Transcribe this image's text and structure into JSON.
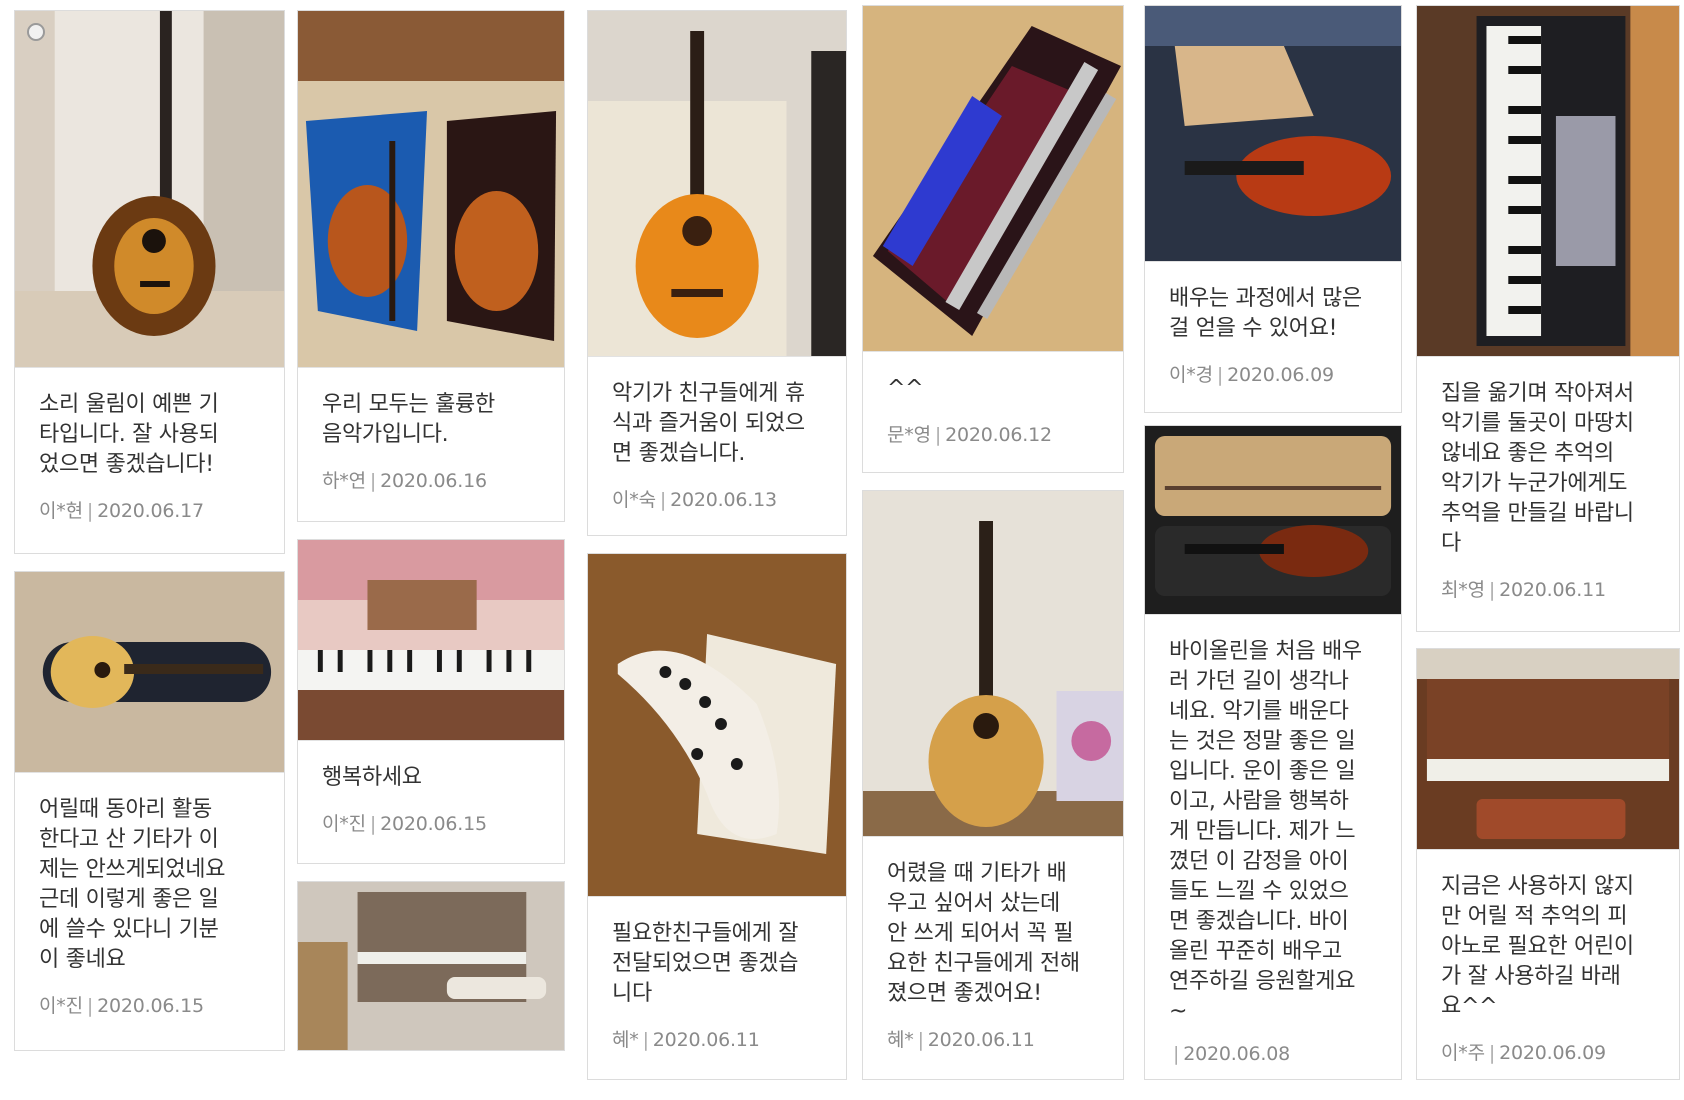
{
  "cards": [
    {
      "message": "소리 울림이 예쁜 기\n타입니다. 잘 사용되\n었으면 좋겠습니다!",
      "author": "이*현",
      "date": "2020.06.17",
      "photo": "acoustic-guitar-sunburst-photo"
    },
    {
      "message": "어릴때 동아리 활동\n한다고 산 기타가 이\n제는 안쓰게되었네요\n근데 이렇게 좋은 일\n에 쓸수 있다니 기분\n이 좋네요",
      "author": "이*진",
      "date": "2020.06.15",
      "photo": "guitar-in-case-photo"
    },
    {
      "message": "우리 모두는 훌륭한\n음악가입니다.",
      "author": "하*연",
      "date": "2020.06.16",
      "photo": "violins-in-cases-photo"
    },
    {
      "message": "행복하세요",
      "author": "이*진",
      "date": "2020.06.15",
      "photo": "keyboard-piano-photo"
    },
    {
      "message": "",
      "author": "",
      "date": "",
      "photo": "upright-piano-photo"
    },
    {
      "message": "악기가 친구들에게 휴\n식과 즐거움이 되었으\n면 좋겠습니다.",
      "author": "이*숙",
      "date": "2020.06.13",
      "photo": "classical-guitar-photo"
    },
    {
      "message": "필요한친구들에게 잘\n전달되었으면 좋겠습\n니다",
      "author": "혜*",
      "date": "2020.06.11",
      "photo": "ocarina-photo"
    },
    {
      "message": "^^",
      "author": "문*영",
      "date": "2020.06.12",
      "photo": "flute-in-case-photo"
    },
    {
      "message": "어렸을 때 기타가 배\n우고 싶어서 샀는데\n안 쓰게 되어서 꼭 필\n요한 친구들에게 전해\n졌으면 좋겠어요!",
      "author": "혜*",
      "date": "2020.06.11",
      "photo": "acoustic-guitar-wall-photo"
    },
    {
      "message": "배우는 과정에서 많은\n걸 얻을 수 있어요!",
      "author": "이*경",
      "date": "2020.06.09",
      "photo": "violin-case-cloth-photo"
    },
    {
      "message": "바이올린을 처음 배우\n러 가던 길이 생각나\n네요. 악기를 배운다\n는 것은 정말 좋은 일\n입니다. 운이 좋은 일\n이고, 사람을 행복하\n게 만듭니다. 제가 느\n꼈던 이 감정을 아이\n들도 느낄 수 있었으\n면 좋겠습니다. 바이\n올린 꾸준히 배우고\n연주하길 응원할게요\n~",
      "author": "",
      "date": "2020.06.08",
      "photo": "violin-case-open-photo"
    },
    {
      "message": "집을 옮기며 작아져서\n악기를 둘곳이 마땅치\n않네요 좋은 추억의\n악기가 누군가에게도\n추억을 만들길 바랍니\n다",
      "author": "최*영",
      "date": "2020.06.11",
      "photo": "electronic-keyboard-photo"
    },
    {
      "message": "지금은 사용하지 않지\n만 어릴 적 추억의 피\n아노로 필요한 어린이\n가 잘 사용하길 바래\n요^^",
      "author": "이*주",
      "date": "2020.06.09",
      "photo": "brown-upright-piano-photo"
    }
  ]
}
